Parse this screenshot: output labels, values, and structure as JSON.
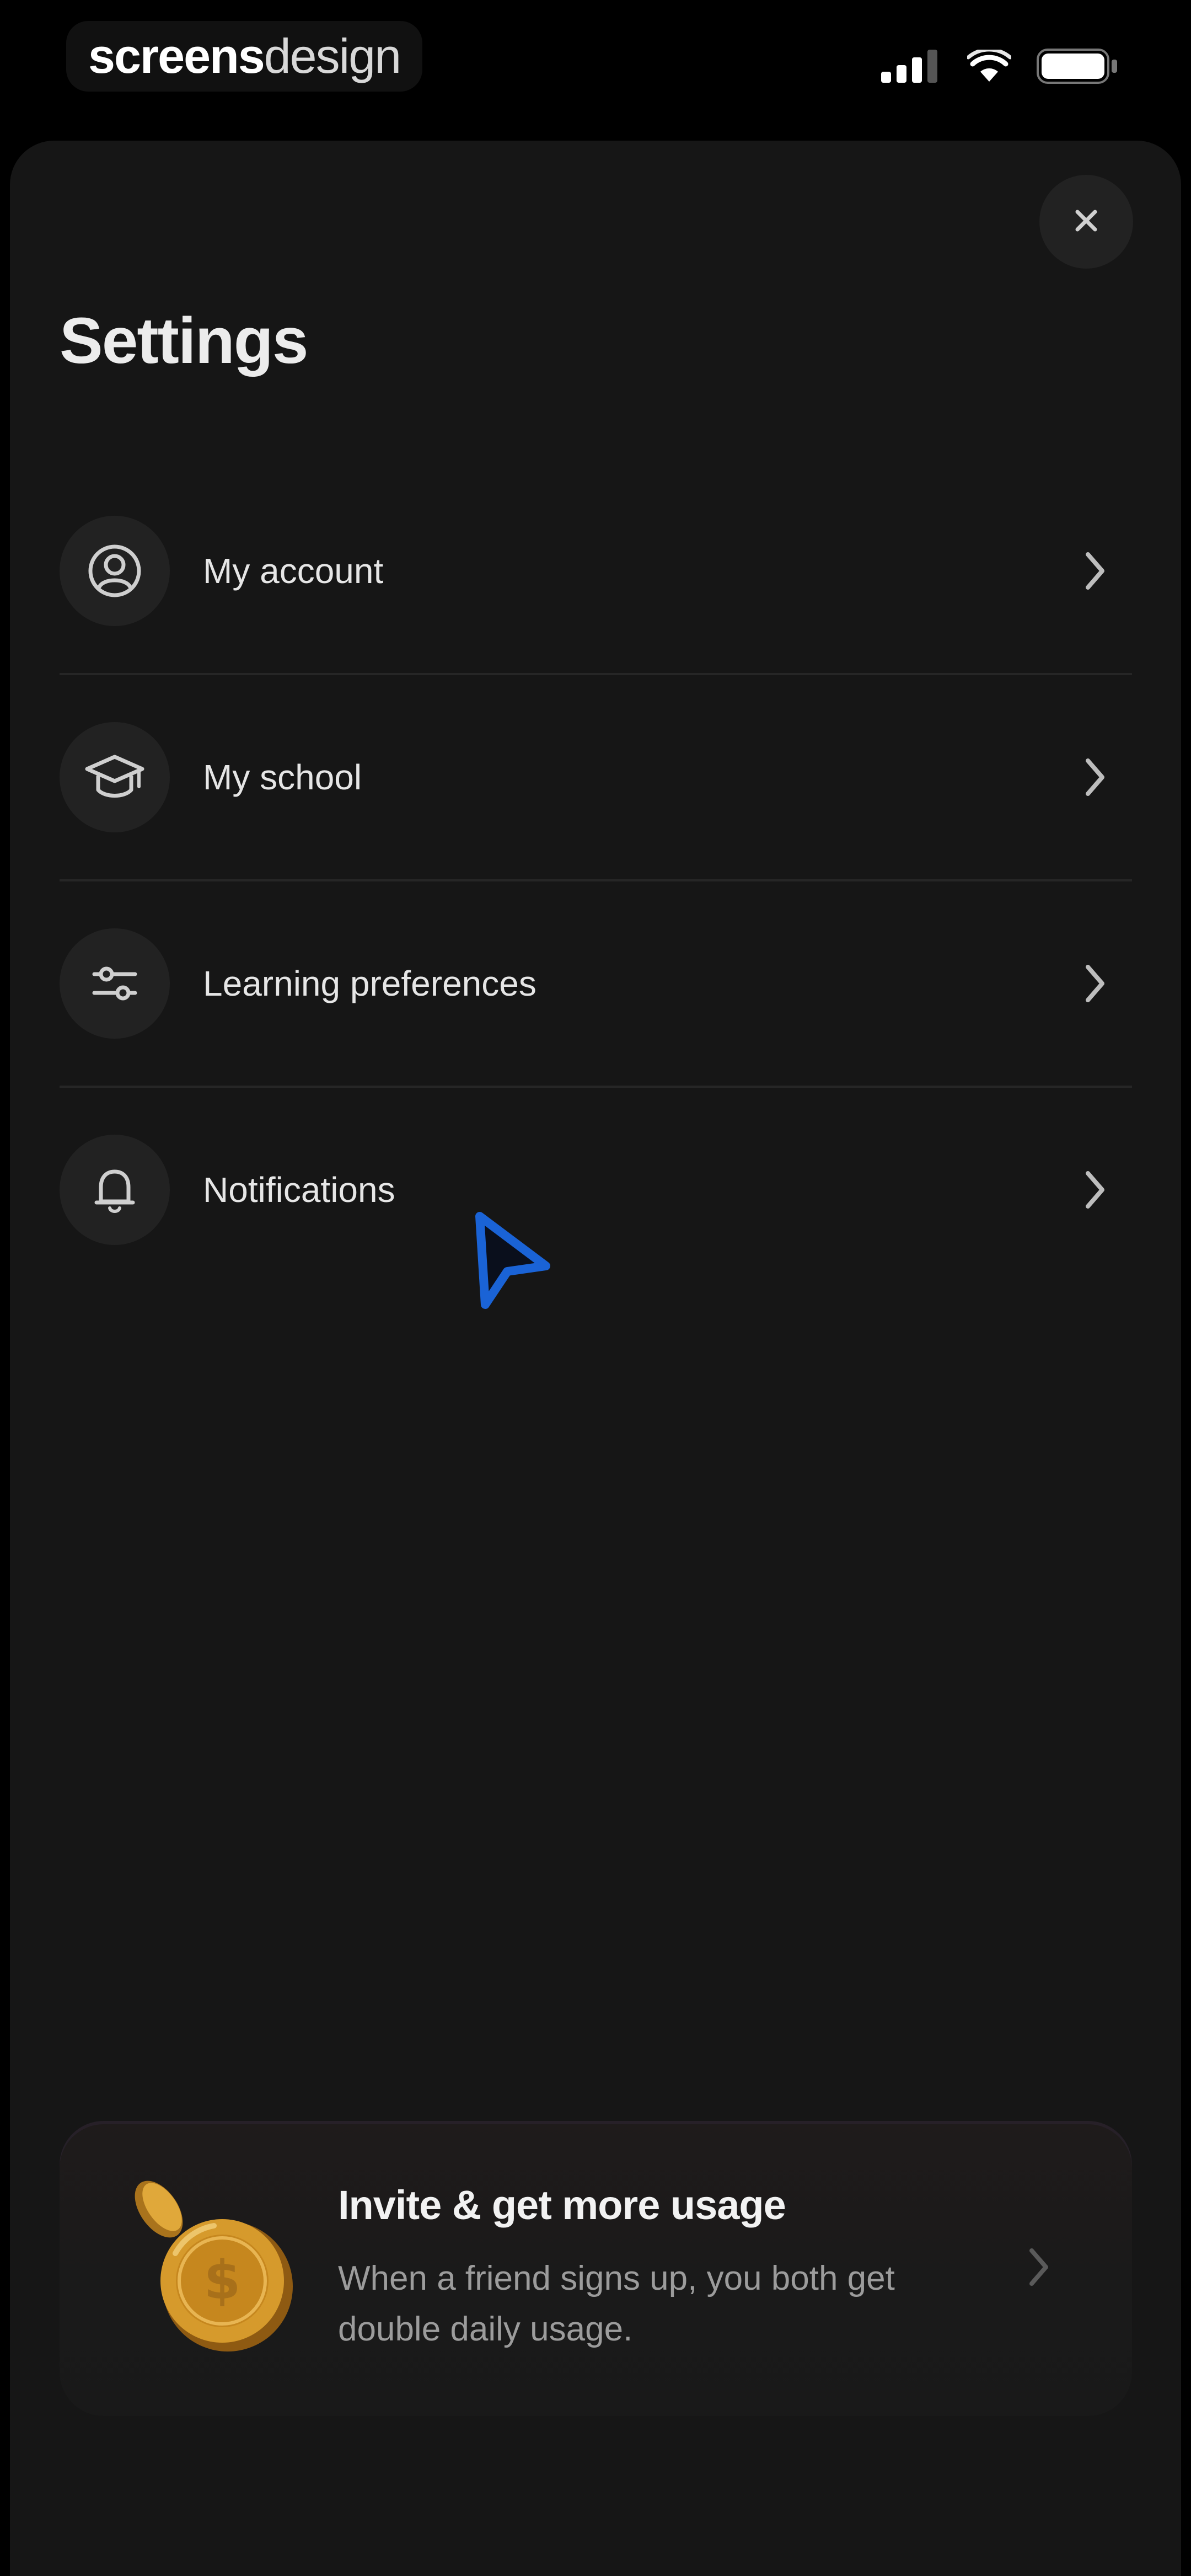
{
  "status_bar": {
    "brand_strong": "screens",
    "brand_light": "design",
    "icons": [
      "signal-icon",
      "wifi-icon",
      "battery-icon"
    ]
  },
  "sheet": {
    "title": "Settings",
    "close_icon": "close-icon"
  },
  "menu": {
    "items": [
      {
        "label": "My account",
        "icon": "user-circle-icon"
      },
      {
        "label": "My school",
        "icon": "graduation-cap-icon"
      },
      {
        "label": "Learning preferences",
        "icon": "sliders-icon"
      },
      {
        "label": "Notifications",
        "icon": "bell-icon"
      }
    ]
  },
  "invite": {
    "title": "Invite & get more usage",
    "description": "When a friend signs up, you both get double daily usage."
  },
  "colors": {
    "background": "#000000",
    "sheet": "#161616",
    "icon_circle": "#222222",
    "text_primary": "#e6e6e6",
    "text_secondary": "#9c9c9c",
    "cursor": "#1a63d6",
    "coin": "#d69a2c"
  }
}
